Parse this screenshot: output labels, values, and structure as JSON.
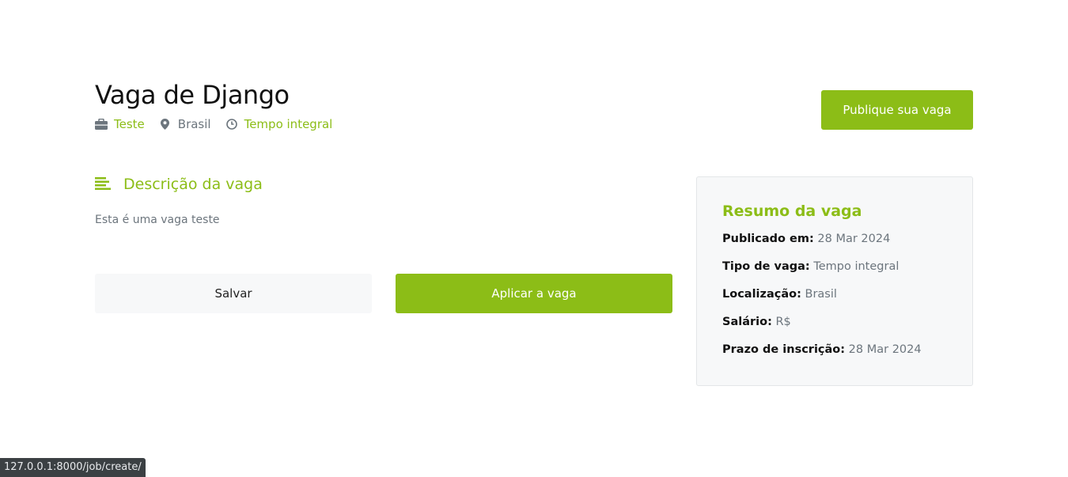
{
  "job": {
    "title": "Vaga de Django",
    "company": "Teste",
    "location": "Brasil",
    "type": "Tempo integral"
  },
  "header": {
    "publish_label": "Publique sua vaga"
  },
  "description": {
    "heading": "Descrição da vaga",
    "text": "Esta é uma vaga teste"
  },
  "actions": {
    "save_label": "Salvar",
    "apply_label": "Aplicar a vaga"
  },
  "summary": {
    "title": "Resumo da vaga",
    "rows": [
      {
        "label": "Publicado em:",
        "value": "28 Mar 2024"
      },
      {
        "label": "Tipo de vaga:",
        "value": "Tempo integral"
      },
      {
        "label": "Localização:",
        "value": "Brasil"
      },
      {
        "label": "Salário:",
        "value": "R$"
      },
      {
        "label": "Prazo de inscrição:",
        "value": "28 Mar 2024"
      }
    ]
  },
  "status_bar": {
    "url": "127.0.0.1:8000/job/create/"
  },
  "icons": {
    "company": "briefcase-icon",
    "location": "map-marker-icon",
    "type": "clock-icon",
    "description": "align-left-icon"
  },
  "colors": {
    "accent": "#8cbd17",
    "text_muted": "#6c757d",
    "card_bg": "#f7f8f9"
  }
}
